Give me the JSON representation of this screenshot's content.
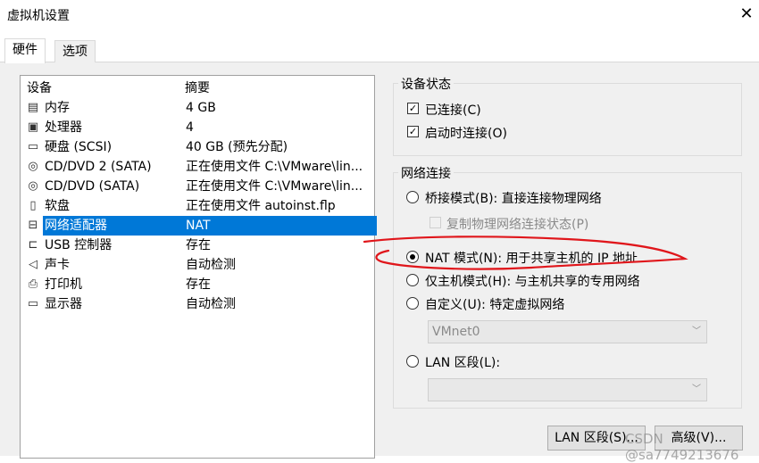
{
  "window": {
    "title": "虚拟机设置",
    "close_glyph": "✕"
  },
  "tabs": [
    {
      "label": "硬件",
      "active": true
    },
    {
      "label": "选项",
      "active": false
    }
  ],
  "device_list": {
    "columns": [
      "设备",
      "摘要"
    ],
    "rows": [
      {
        "name": "内存",
        "summary": "4 GB",
        "icon": "memory-icon"
      },
      {
        "name": "处理器",
        "summary": "4",
        "icon": "cpu-icon"
      },
      {
        "name": "硬盘 (SCSI)",
        "summary": "40 GB (预先分配)",
        "icon": "harddisk-icon"
      },
      {
        "name": "CD/DVD 2 (SATA)",
        "summary": "正在使用文件 C:\\VMware\\lin...",
        "icon": "cd-icon"
      },
      {
        "name": "CD/DVD (SATA)",
        "summary": "正在使用文件 C:\\VMware\\lin...",
        "icon": "cd-icon"
      },
      {
        "name": "软盘",
        "summary": "正在使用文件 autoinst.flp",
        "icon": "floppy-icon"
      },
      {
        "name": "网络适配器",
        "summary": "NAT",
        "icon": "network-icon",
        "selected": true
      },
      {
        "name": "USB 控制器",
        "summary": "存在",
        "icon": "usb-icon"
      },
      {
        "name": "声卡",
        "summary": "自动检测",
        "icon": "speaker-icon"
      },
      {
        "name": "打印机",
        "summary": "存在",
        "icon": "printer-icon"
      },
      {
        "name": "显示器",
        "summary": "自动检测",
        "icon": "monitor-icon"
      }
    ]
  },
  "device_status": {
    "legend": "设备状态",
    "connected": {
      "label": "已连接(C)",
      "checked": true
    },
    "connect_at_power_on": {
      "label": "启动时连接(O)",
      "checked": true
    }
  },
  "network": {
    "legend": "网络连接",
    "bridged": {
      "label": "桥接模式(B): 直接连接物理网络",
      "selected": false
    },
    "replicate": {
      "label": "复制物理网络连接状态(P)",
      "checked": false,
      "enabled": false
    },
    "nat": {
      "label": "NAT 模式(N): 用于共享主机的 IP 地址",
      "selected": true
    },
    "host_only": {
      "label": "仅主机模式(H): 与主机共享的专用网络",
      "selected": false
    },
    "custom": {
      "label": "自定义(U): 特定虚拟网络",
      "selected": false
    },
    "custom_select": {
      "value": "VMnet0",
      "enabled": false
    },
    "lan_segment": {
      "label": "LAN 区段(L):",
      "selected": false
    },
    "lan_select": {
      "value": "",
      "enabled": false
    }
  },
  "buttons": {
    "lan_segments": "LAN 区段(S)...",
    "advanced": "高级(V)..."
  },
  "watermark": "CSDN @sa7749213676",
  "colors": {
    "selection": "#0078d7",
    "annotation": "#e0161b"
  }
}
